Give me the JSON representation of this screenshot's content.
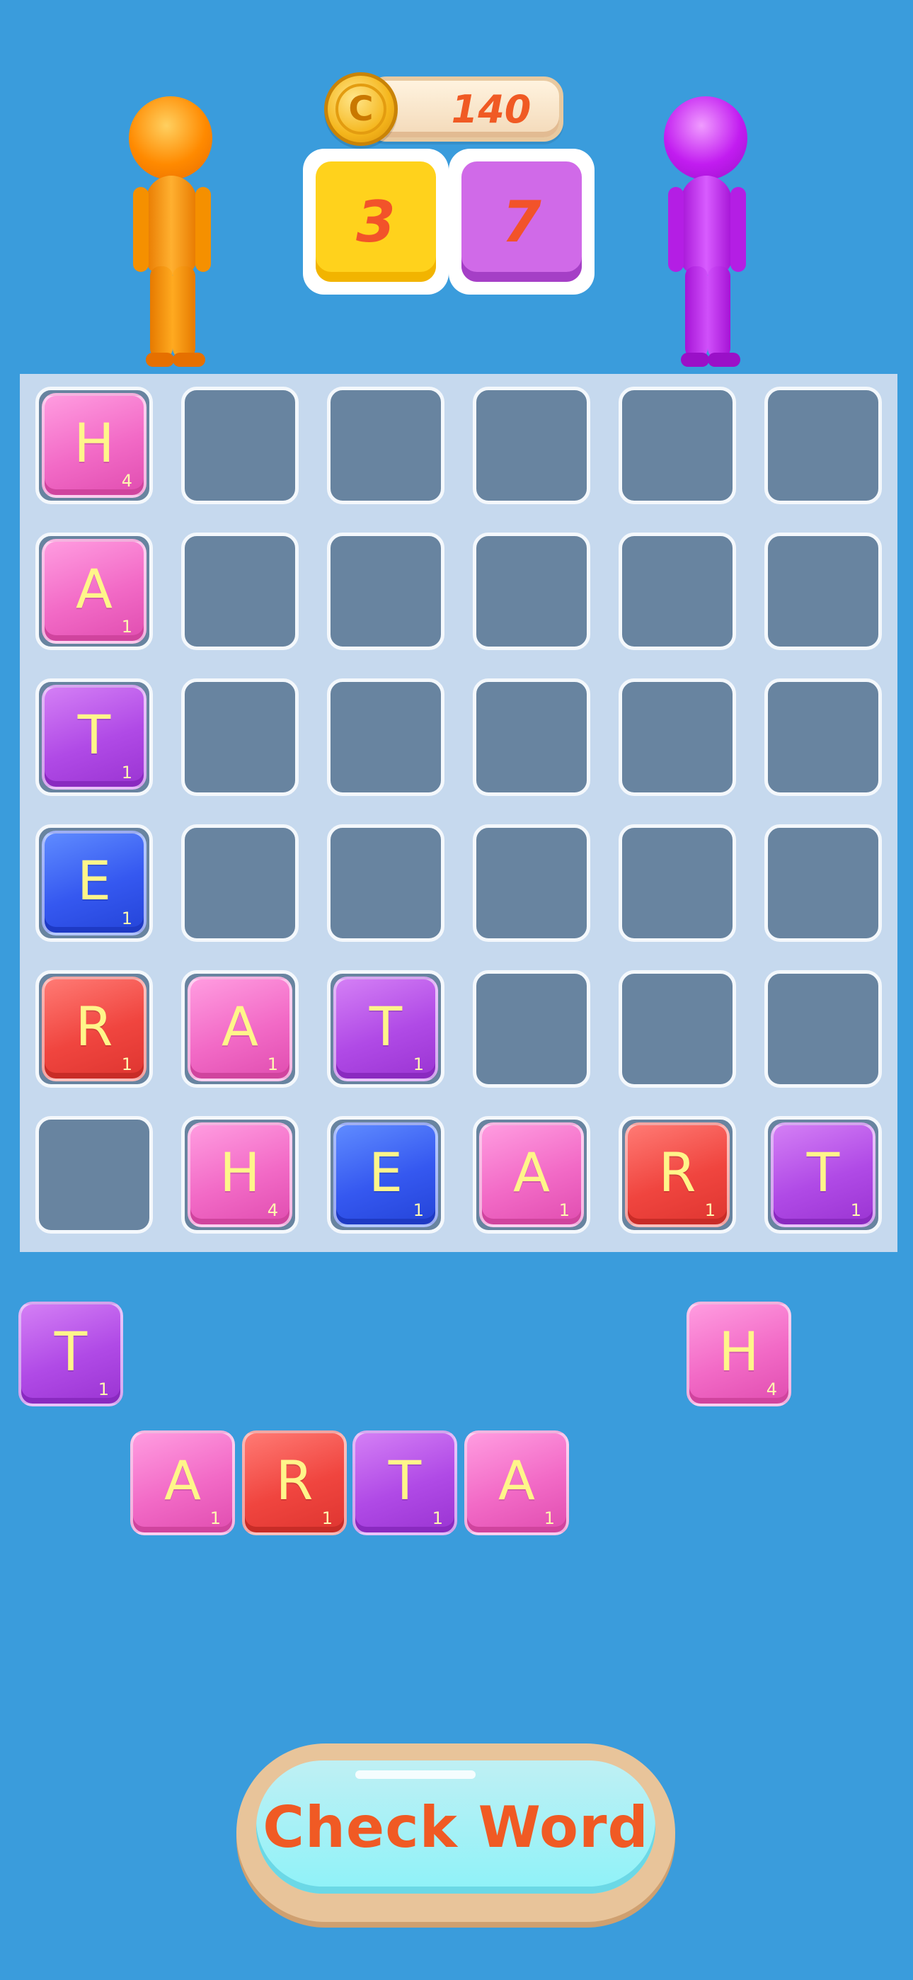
{
  "header": {
    "coins": "140",
    "coin_icon": "coin-icon",
    "coin_symbol": "C",
    "player_score": "3",
    "opponent_score": "7"
  },
  "players": {
    "player_color": "#ff8a00",
    "opponent_color": "#c21cf0"
  },
  "board": {
    "rows": 6,
    "cols": 6,
    "tiles": [
      {
        "row": 0,
        "col": 0,
        "letter": "H",
        "points": "4",
        "color": "pink"
      },
      {
        "row": 1,
        "col": 0,
        "letter": "A",
        "points": "1",
        "color": "pink"
      },
      {
        "row": 2,
        "col": 0,
        "letter": "T",
        "points": "1",
        "color": "purple"
      },
      {
        "row": 3,
        "col": 0,
        "letter": "E",
        "points": "1",
        "color": "blue"
      },
      {
        "row": 4,
        "col": 0,
        "letter": "R",
        "points": "1",
        "color": "red"
      },
      {
        "row": 4,
        "col": 1,
        "letter": "A",
        "points": "1",
        "color": "pink"
      },
      {
        "row": 4,
        "col": 2,
        "letter": "T",
        "points": "1",
        "color": "purple"
      },
      {
        "row": 5,
        "col": 1,
        "letter": "H",
        "points": "4",
        "color": "pink"
      },
      {
        "row": 5,
        "col": 2,
        "letter": "E",
        "points": "1",
        "color": "blue"
      },
      {
        "row": 5,
        "col": 3,
        "letter": "A",
        "points": "1",
        "color": "pink"
      },
      {
        "row": 5,
        "col": 4,
        "letter": "R",
        "points": "1",
        "color": "red"
      },
      {
        "row": 5,
        "col": 5,
        "letter": "T",
        "points": "1",
        "color": "purple"
      }
    ]
  },
  "rack": {
    "tiles": [
      {
        "letter": "T",
        "points": "1",
        "color": "purple"
      },
      {
        "letter": "H",
        "points": "4",
        "color": "pink"
      },
      {
        "letter": "A",
        "points": "1",
        "color": "pink"
      },
      {
        "letter": "R",
        "points": "1",
        "color": "red"
      },
      {
        "letter": "T",
        "points": "1",
        "color": "purple"
      },
      {
        "letter": "A",
        "points": "1",
        "color": "pink"
      }
    ]
  },
  "actions": {
    "check_word_label": "Check Word"
  }
}
